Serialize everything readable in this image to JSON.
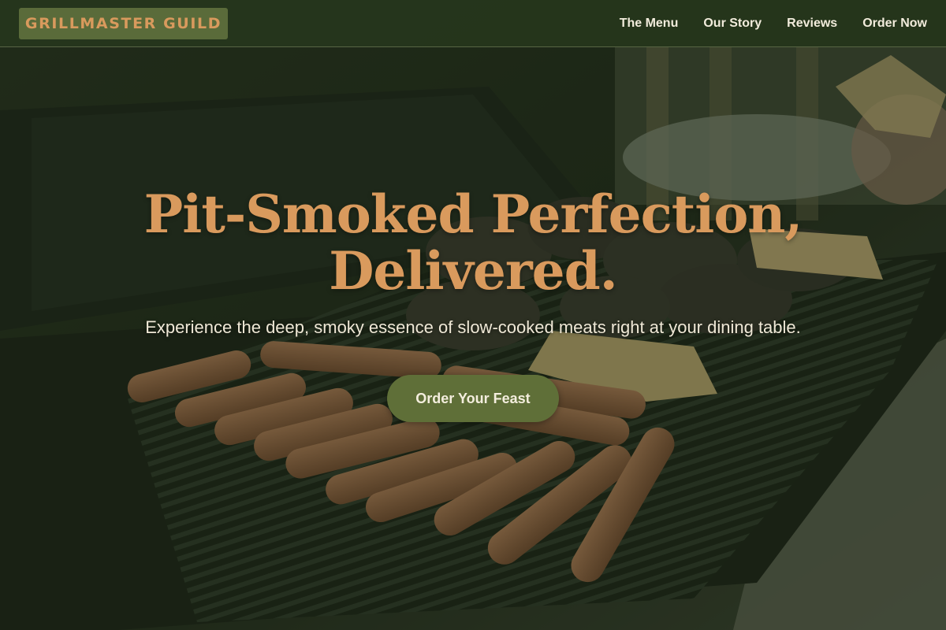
{
  "header": {
    "brand": "GRILLMASTER GUILD",
    "nav": [
      {
        "label": "The Menu"
      },
      {
        "label": "Our Story"
      },
      {
        "label": "Reviews"
      },
      {
        "label": "Order Now"
      }
    ]
  },
  "hero": {
    "title_line1": "Pit-Smoked Perfection,",
    "title_line2": "Delivered.",
    "subtitle": "Experience the deep, smoky essence of slow-cooked meats right at your dining table.",
    "cta_label": "Order Your Feast"
  },
  "colors": {
    "accent": "#d99a5d",
    "nav_bg": "#25361c",
    "brand_bg": "#5a6b3a",
    "cta_bg": "#5f6f38",
    "text_light": "#efe8d6"
  }
}
